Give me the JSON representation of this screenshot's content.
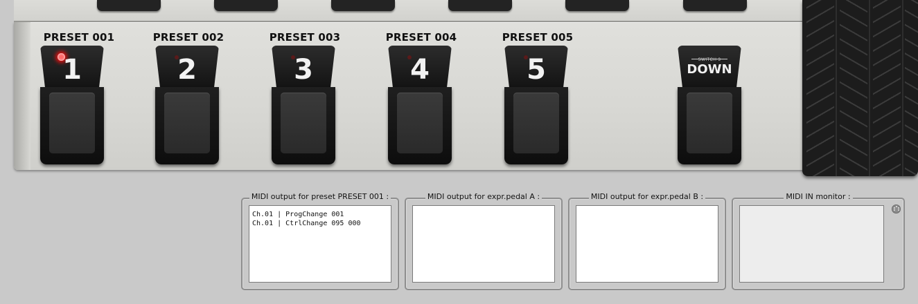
{
  "board": {
    "presets": [
      {
        "label": "PRESET 001",
        "number": "1",
        "active": true
      },
      {
        "label": "PRESET 002",
        "number": "2",
        "active": false
      },
      {
        "label": "PRESET 003",
        "number": "3",
        "active": false
      },
      {
        "label": "PRESET 004",
        "number": "4",
        "active": false
      },
      {
        "label": "PRESET 005",
        "number": "5",
        "active": false
      }
    ],
    "down_switch": {
      "sub_label": "SWITCH 3",
      "label": "DOWN"
    },
    "led_color": "#ff2a2a"
  },
  "monitors": {
    "preset_output": {
      "title": "MIDI output for preset PRESET 001 :",
      "lines": [
        "Ch.01 | ProgChange 001",
        "Ch.01 | CtrlChange 095 000"
      ]
    },
    "expr_a": {
      "title": "MIDI output for expr.pedal A :"
    },
    "expr_b": {
      "title": "MIDI output for expr.pedal B :"
    },
    "midi_in": {
      "title": "MIDI IN monitor :",
      "icon": "midi-connector-icon"
    }
  }
}
